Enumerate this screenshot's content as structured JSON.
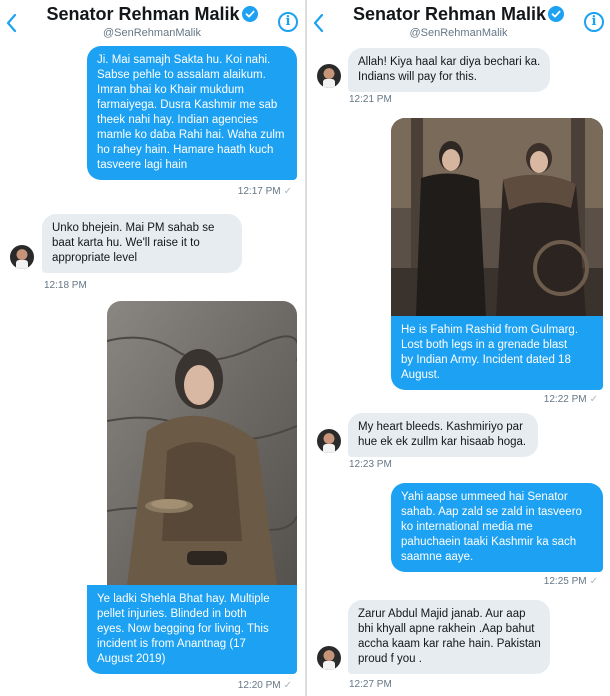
{
  "colors": {
    "accent": "#1da1f2",
    "incoming_bubble": "#e6ecf0",
    "timestamp": "#657786"
  },
  "icons": {
    "back": "chevron-left-icon",
    "info": "info-icon",
    "verified": "verified-badge-icon",
    "read_receipt": "check-icon"
  },
  "left_pane": {
    "header": {
      "title": "Senator Rehman Malik",
      "handle": "@SenRehmanMalik",
      "info_glyph": "i"
    },
    "messages": [
      {
        "direction": "outgoing",
        "lines": [
          "Ji. Mai samajh Sakta hu. Koi nahi.",
          "Sabse pehle to assalam alaikum.",
          "Imran bhai ko Khair mukdum",
          "farmaiyega. Dusra Kashmir me sab",
          "theek nahi hay. Indian agencies",
          "mamle ko daba Rahi hai. Waha zulm",
          "ho rahey hain. Hamare haath kuch",
          "tasveere lagi hain"
        ],
        "time": "12:17 PM",
        "receipt": "✓"
      },
      {
        "direction": "incoming",
        "lines": [
          "Unko bhejein. Mai PM sahab se",
          "baat karta hu. We'll raise it to",
          "appropriate level"
        ],
        "time": "12:18 PM"
      },
      {
        "direction": "outgoing",
        "has_photo": true,
        "lines": [
          "Ye ladki Shehla Bhat hay. Multiple",
          "pellet injuries. Blinded in both",
          "eyes. Now begging for living. This",
          "incident is from Anantnag (17",
          "August 2019)"
        ],
        "time": "12:20 PM",
        "receipt": "✓"
      }
    ]
  },
  "right_pane": {
    "header": {
      "title": "Senator Rehman Malik",
      "handle": "@SenRehmanMalik",
      "info_glyph": "i"
    },
    "messages": [
      {
        "direction": "incoming",
        "lines": [
          "Allah! Kiya haal kar diya bechari ka.",
          "Indians will pay for this."
        ],
        "time": "12:21 PM"
      },
      {
        "direction": "outgoing",
        "has_photo": true,
        "lines": [
          "He is Fahim Rashid from Gulmarg.",
          "Lost both legs in a grenade blast",
          "by Indian Army. Incident dated 18",
          "August."
        ],
        "time": "12:22 PM",
        "receipt": "✓"
      },
      {
        "direction": "incoming",
        "lines": [
          "My heart bleeds. Kashmiriyo par",
          "hue ek ek zullm kar hisaab hoga."
        ],
        "time": "12:23 PM"
      },
      {
        "direction": "outgoing",
        "lines": [
          "Yahi aapse ummeed hai Senator",
          "sahab. Aap zald se zald in tasveero",
          "ko international media me",
          "pahuchaein taaki Kashmir ka sach",
          "saamne aaye."
        ],
        "time": "12:25 PM",
        "receipt": "✓"
      },
      {
        "direction": "incoming",
        "lines": [
          "Zarur Abdul Majid janab. Aur aap",
          "bhi khyall apne rakhein .Aap bahut",
          "accha kaam kar rahe hain. Pakistan",
          "proud f you ."
        ],
        "time": "12:27 PM"
      }
    ]
  }
}
